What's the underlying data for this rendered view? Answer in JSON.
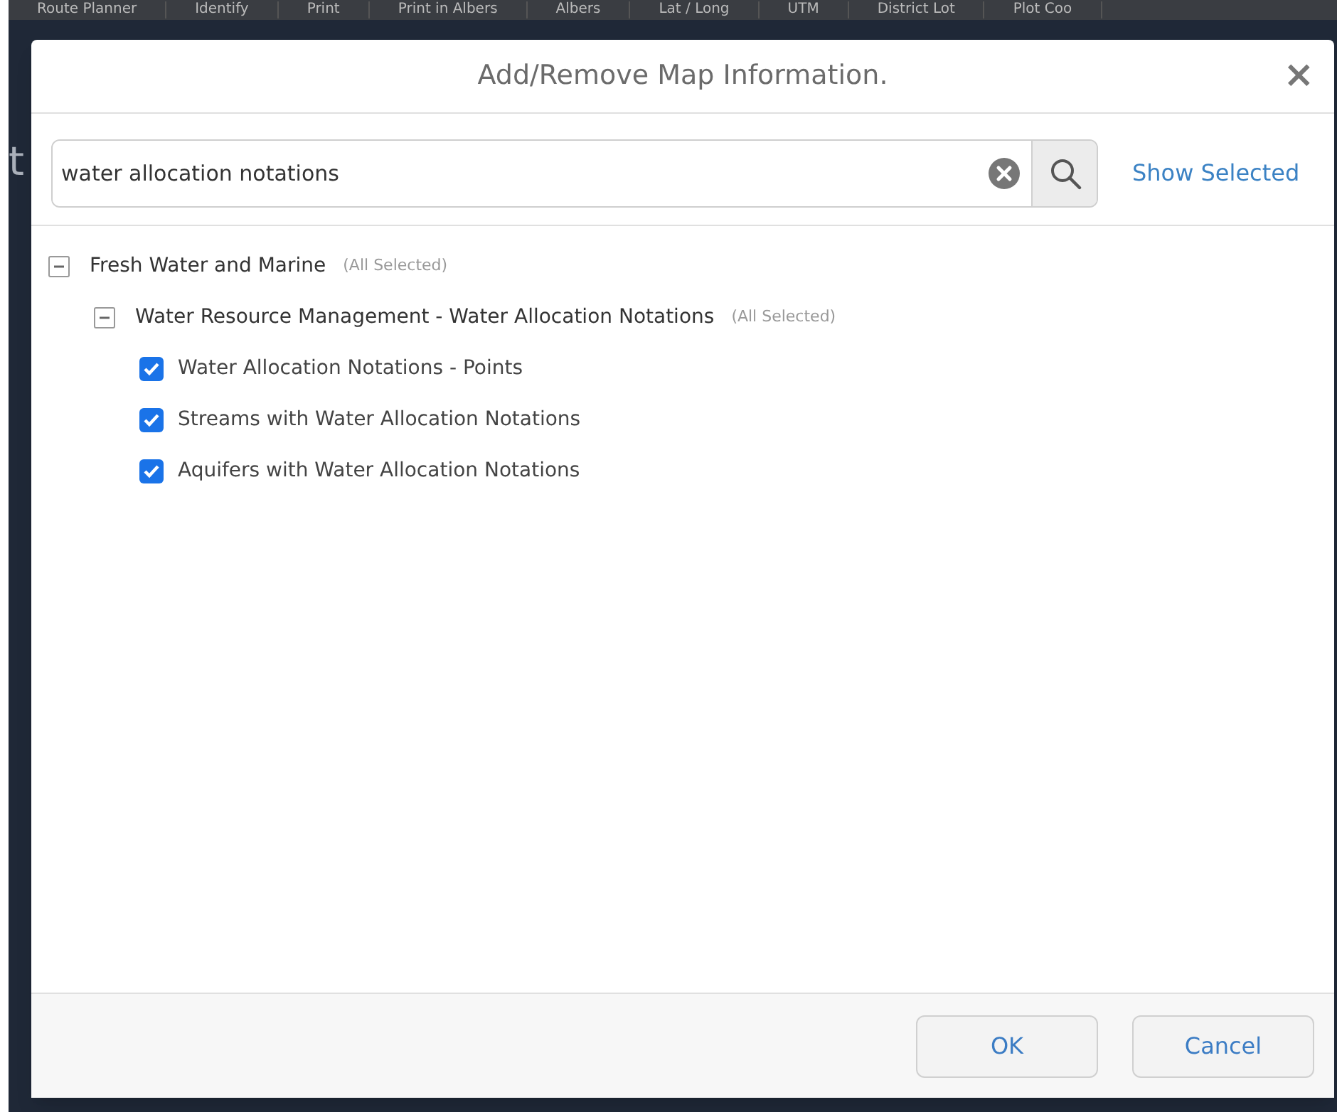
{
  "toolbar": {
    "items": [
      "Route Planner",
      "Identify",
      "Print",
      "Print in Albers",
      "Albers",
      "Lat / Long",
      "UTM",
      "District Lot",
      "Plot Coo"
    ]
  },
  "background": {
    "fragment": "t"
  },
  "dialog": {
    "title": "Add/Remove Map Information.",
    "close": "×",
    "search": {
      "value": "water allocation notations"
    },
    "show_selected": "Show Selected",
    "tree": [
      {
        "label": "Fresh Water and Marine",
        "note": "(All Selected)",
        "kind": "group",
        "expanded": true,
        "children": [
          {
            "label": "Water Resource Management - Water Allocation Notations",
            "note": "(All Selected)",
            "kind": "group",
            "expanded": true,
            "children": [
              {
                "label": "Water Allocation Notations - Points",
                "kind": "layer",
                "checked": true
              },
              {
                "label": "Streams with Water Allocation Notations",
                "kind": "layer",
                "checked": true
              },
              {
                "label": "Aquifers with Water Allocation Notations",
                "kind": "layer",
                "checked": true
              }
            ]
          }
        ]
      }
    ],
    "buttons": [
      "OK",
      "Cancel"
    ]
  }
}
